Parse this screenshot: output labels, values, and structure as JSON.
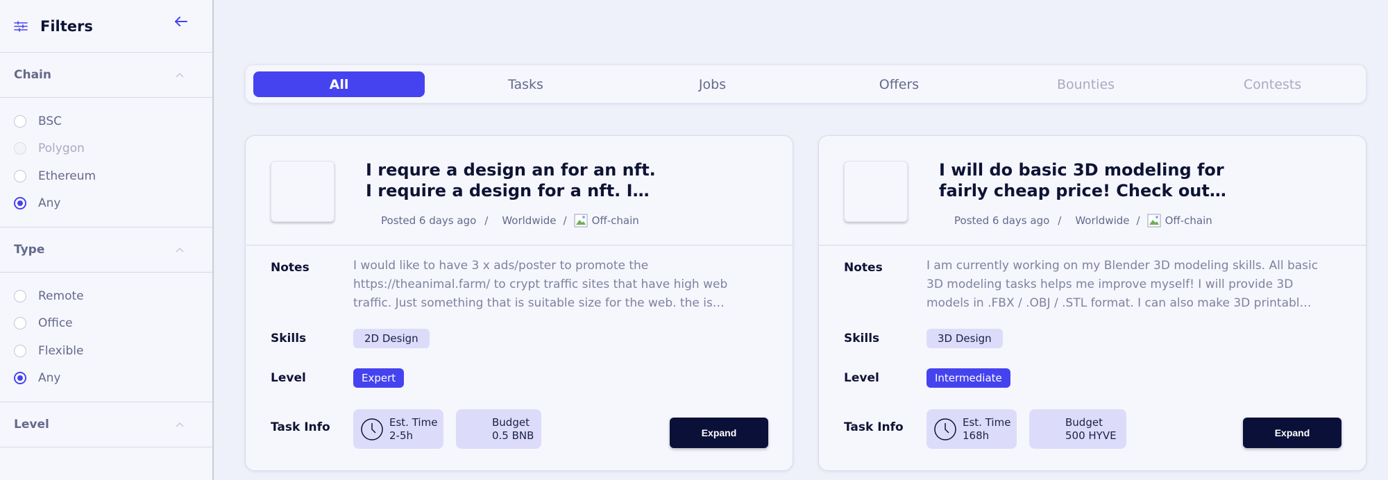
{
  "sidebar": {
    "title": "Filters",
    "sections": [
      {
        "label": "Chain",
        "options": [
          {
            "label": "BSC",
            "state": "off"
          },
          {
            "label": "Polygon",
            "state": "disabled"
          },
          {
            "label": "Ethereum",
            "state": "off"
          },
          {
            "label": "Any",
            "state": "selected"
          }
        ]
      },
      {
        "label": "Type",
        "options": [
          {
            "label": "Remote",
            "state": "off"
          },
          {
            "label": "Office",
            "state": "off"
          },
          {
            "label": "Flexible",
            "state": "off"
          },
          {
            "label": "Any",
            "state": "selected"
          }
        ]
      },
      {
        "label": "Level",
        "options": []
      }
    ]
  },
  "tabs": [
    {
      "label": "All",
      "state": "active"
    },
    {
      "label": "Tasks",
      "state": "normal"
    },
    {
      "label": "Jobs",
      "state": "normal"
    },
    {
      "label": "Offers",
      "state": "normal"
    },
    {
      "label": "Bounties",
      "state": "muted"
    },
    {
      "label": "Contests",
      "state": "muted"
    }
  ],
  "labels": {
    "notes": "Notes",
    "skills": "Skills",
    "level": "Level",
    "task_info": "Task Info",
    "est_time": "Est. Time",
    "budget": "Budget",
    "expand": "Expand",
    "sep": "/"
  },
  "cards": [
    {
      "title": "I requre a design an for an nft. I require a design for a nft. I…",
      "posted": "Posted 6 days ago",
      "location": "Worldwide",
      "chain": "Off-chain",
      "notes": "I would like to have 3 x ads/poster to promote the https://theanimal.farm/ to crypt traffic sites that have high web traffic. Just something that is suitable size for the web. the is…",
      "skill": "2D Design",
      "level": "Expert",
      "est_time": "2-5h",
      "budget": "0.5 BNB"
    },
    {
      "title": "I will do basic 3D modeling for fairly cheap price! Check out…",
      "posted": "Posted 6 days ago",
      "location": "Worldwide",
      "chain": "Off-chain",
      "notes": "I am currently working on my Blender 3D modeling skills. All basic 3D modeling tasks helps me improve myself! I will provide 3D models in .FBX / .OBJ / .STL format. I can also make 3D printabl…",
      "skill": "3D Design",
      "level": "Intermediate",
      "est_time": "168h",
      "budget": "500 HYVE"
    }
  ],
  "colors": {
    "accent": "#4543ef",
    "dark": "#0b1038",
    "chip": "#dcdcfa",
    "background": "#eef0fa"
  }
}
